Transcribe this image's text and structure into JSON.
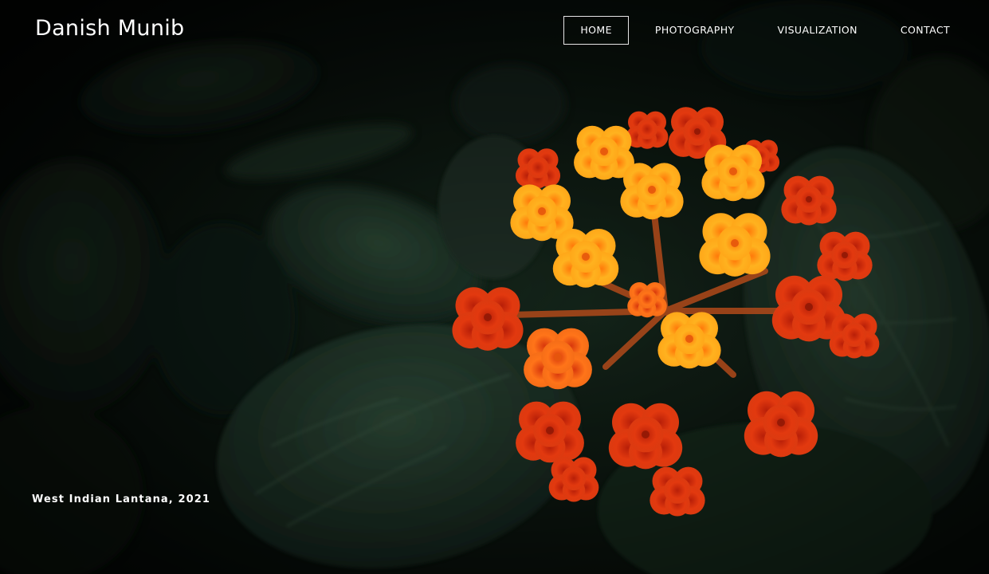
{
  "site": {
    "title": "Danish Munib"
  },
  "nav": {
    "items": [
      {
        "label": "HOME",
        "active": true
      },
      {
        "label": "PHOTOGRAPHY",
        "active": false
      },
      {
        "label": "VISUALIZATION",
        "active": false
      },
      {
        "label": "CONTACT",
        "active": false
      }
    ]
  },
  "hero": {
    "caption": "West Indian Lantana, 2021",
    "colors": {
      "background": "#050806",
      "leaf": "#1d3325",
      "flower_orange": "#ff9f1a",
      "flower_red": "#e23a10"
    }
  }
}
